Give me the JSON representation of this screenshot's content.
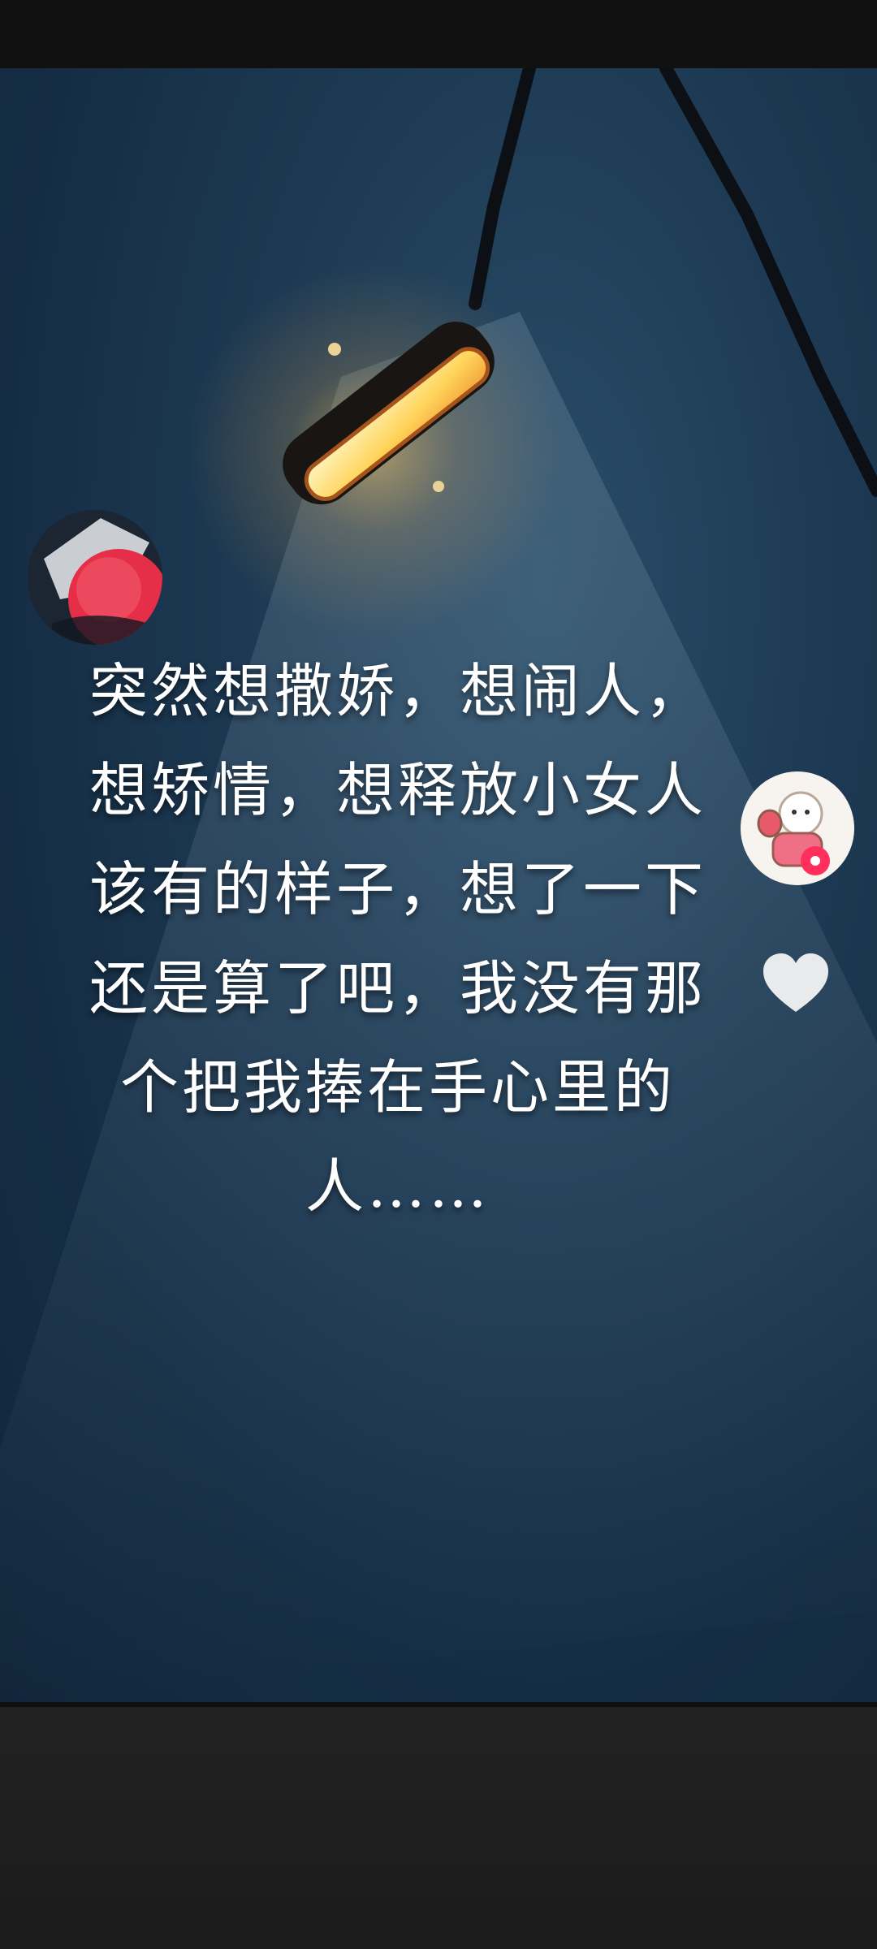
{
  "caption": {
    "lines": [
      "突然想撒娇，想闹人，",
      "想矫情，想释放小女人",
      "该有的样子，想了一下",
      "还是算了吧，我没有那",
      "个把我捧在手心里的",
      "人……"
    ]
  },
  "scene": {
    "background": "night-sky-blue",
    "light_color": "#ffd36a",
    "sky_color": "#1a3550"
  },
  "icons": {
    "left_sticker": "red-glass-sticker",
    "right_sticker": "cartoon-character-sticker",
    "heart": "heart-icon"
  }
}
